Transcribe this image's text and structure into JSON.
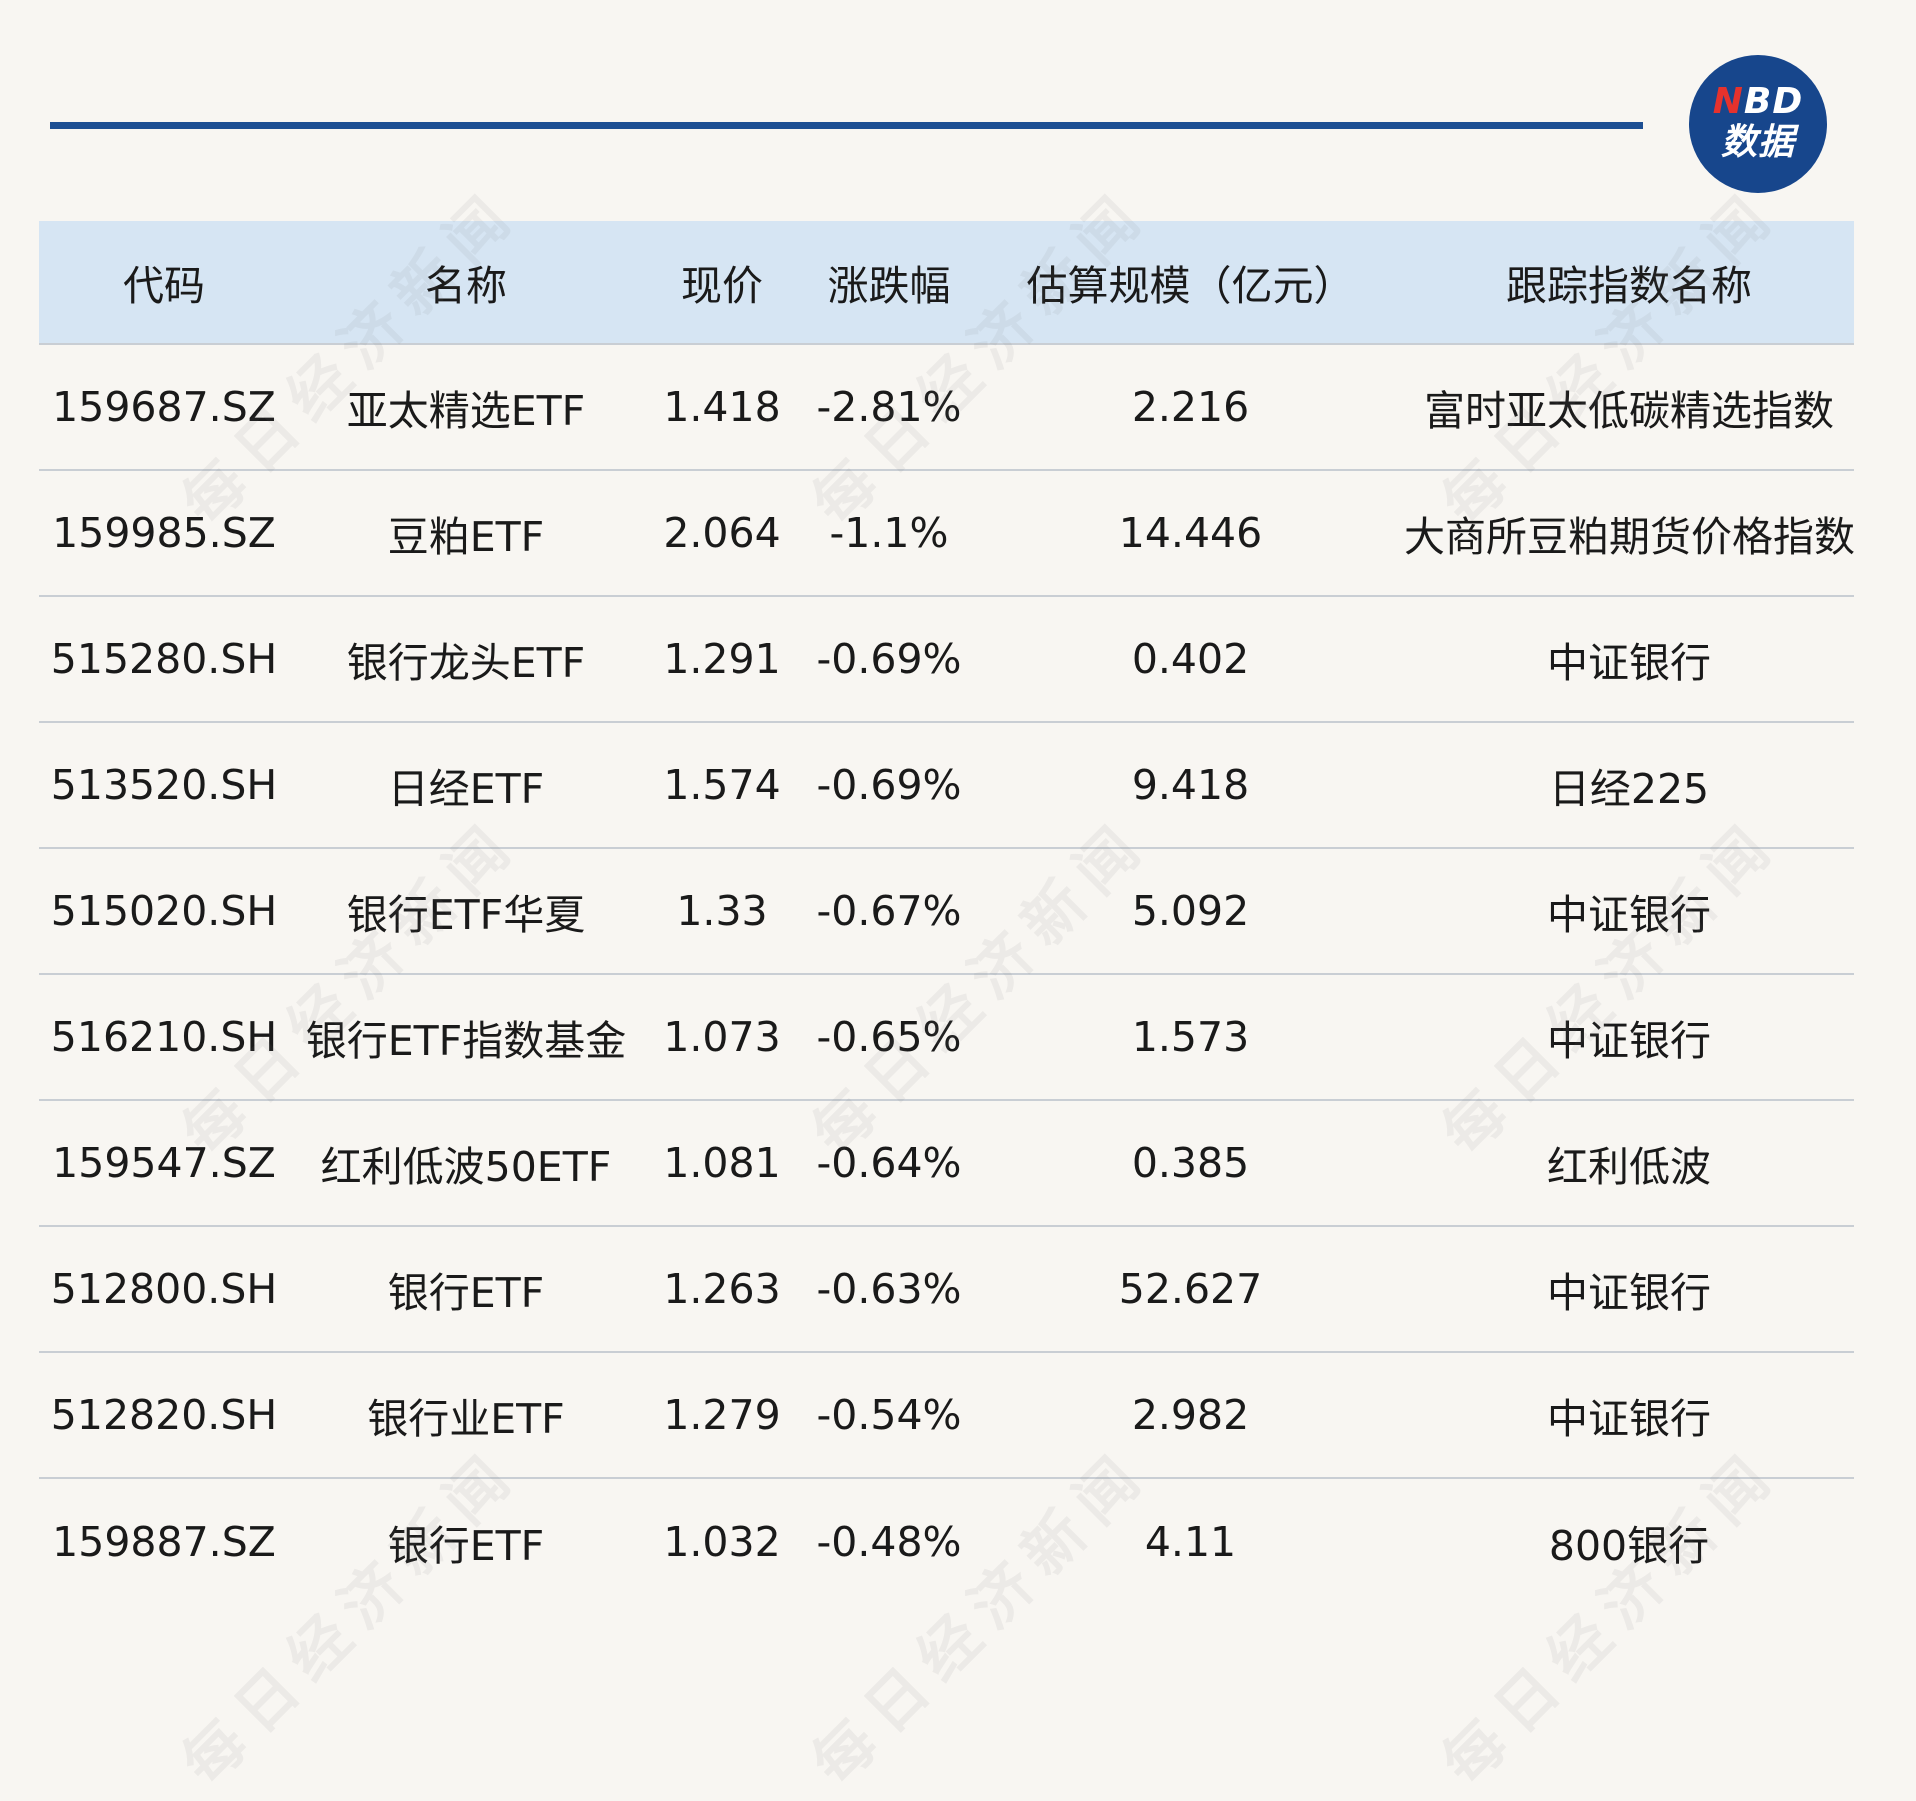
{
  "logo": {
    "line1_n": "N",
    "line1_rest": "BD",
    "line2": "数据"
  },
  "watermark_text": "每日经济新闻",
  "table": {
    "headers": [
      "代码",
      "名称",
      "现价",
      "涨跌幅",
      "估算规模（亿元）",
      "跟踪指数名称"
    ],
    "rows": [
      [
        "159687.SZ",
        "亚太精选ETF",
        "1.418",
        "-2.81%",
        "2.216",
        "富时亚太低碳精选指数"
      ],
      [
        "159985.SZ",
        "豆粕ETF",
        "2.064",
        "-1.1%",
        "14.446",
        "大商所豆粕期货价格指数"
      ],
      [
        "515280.SH",
        "银行龙头ETF",
        "1.291",
        "-0.69%",
        "0.402",
        "中证银行"
      ],
      [
        "513520.SH",
        "日经ETF",
        "1.574",
        "-0.69%",
        "9.418",
        "日经225"
      ],
      [
        "515020.SH",
        "银行ETF华夏",
        "1.33",
        "-0.67%",
        "5.092",
        "中证银行"
      ],
      [
        "516210.SH",
        "银行ETF指数基金",
        "1.073",
        "-0.65%",
        "1.573",
        "中证银行"
      ],
      [
        "159547.SZ",
        "红利低波50ETF",
        "1.081",
        "-0.64%",
        "0.385",
        "红利低波"
      ],
      [
        "512800.SH",
        "银行ETF",
        "1.263",
        "-0.63%",
        "52.627",
        "中证银行"
      ],
      [
        "512820.SH",
        "银行业ETF",
        "1.279",
        "-0.54%",
        "2.982",
        "中证银行"
      ],
      [
        "159887.SZ",
        "银行ETF",
        "1.032",
        "-0.48%",
        "4.11",
        "800银行"
      ]
    ]
  },
  "colors": {
    "page_background": "#f8f6f2",
    "rule_blue": "#1d4f93",
    "header_background": "#d6e5f3",
    "logo_blue": "#17468c",
    "logo_red": "#e5322d",
    "row_divider": "#c9ced4"
  }
}
